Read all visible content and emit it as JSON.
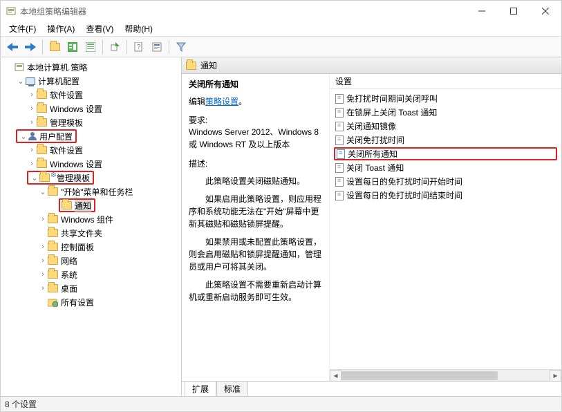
{
  "window": {
    "title": "本地组策略编辑器"
  },
  "menu": {
    "file": "文件(F)",
    "action": "操作(A)",
    "view": "查看(V)",
    "help": "帮助(H)"
  },
  "tree": {
    "root": "本地计算机 策略",
    "computer_config": "计算机配置",
    "software_settings": "软件设置",
    "windows_settings": "Windows 设置",
    "admin_templates": "管理模板",
    "user_config": "用户配置",
    "start_menu_taskbar": "\"开始\"菜单和任务栏",
    "notifications": "通知",
    "windows_components": "Windows 组件",
    "shared_folders": "共享文件夹",
    "control_panel": "控制面板",
    "network": "网络",
    "system": "系统",
    "desktop": "桌面",
    "all_settings": "所有设置"
  },
  "details": {
    "header": "通知",
    "policy_title": "关闭所有通知",
    "edit_link_prefix": "编辑",
    "edit_link": "策略设置",
    "edit_link_suffix": "。",
    "req_label": "要求:",
    "req_value": "Windows Server 2012、Windows 8 或 Windows RT 及以上版本",
    "desc_label": "描述:",
    "desc_p1": "此策略设置关闭磁贴通知。",
    "desc_p2": "如果启用此策略设置，则应用程序和系统功能无法在\"开始\"屏幕中更新其磁贴和磁贴锁屏提醒。",
    "desc_p3": "如果禁用或未配置此策略设置，则会启用磁贴和锁屏提醒通知，管理员或用户可将其关闭。",
    "desc_p4": "此策略设置不需要重新启动计算机或重新启动服务即可生效。"
  },
  "settings": {
    "col": "设置",
    "items": [
      "免打扰时间期间关闭呼叫",
      "在锁屏上关闭 Toast 通知",
      "关闭通知镜像",
      "关闭免打扰时间",
      "关闭所有通知",
      "关闭 Toast 通知",
      "设置每日的免打扰时间开始时间",
      "设置每日的免打扰时间结束时间"
    ]
  },
  "tabs": {
    "extended": "扩展",
    "standard": "标准"
  },
  "status": "8 个设置"
}
